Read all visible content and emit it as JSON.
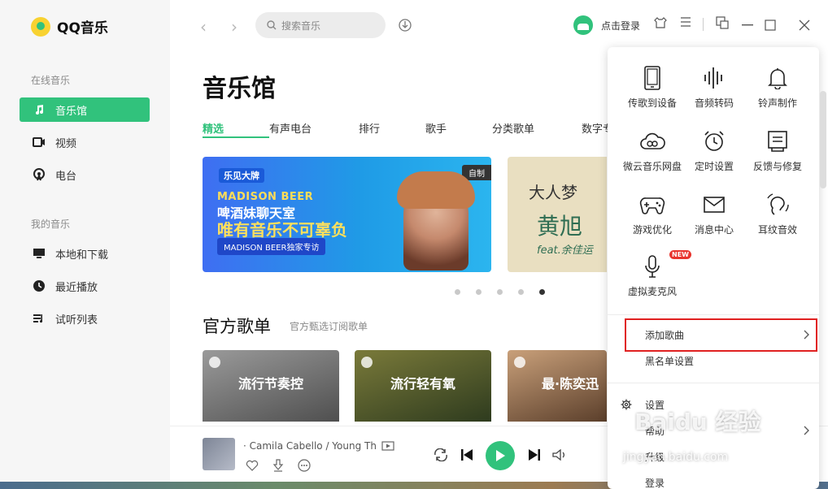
{
  "app": {
    "name": "QQ音乐"
  },
  "sidebar": {
    "section_online": "在线音乐",
    "section_mine": "我的音乐",
    "items": [
      {
        "label": "音乐馆",
        "icon": "music-note-icon",
        "active": true
      },
      {
        "label": "视频",
        "icon": "video-icon"
      },
      {
        "label": "电台",
        "icon": "radio-icon"
      },
      {
        "label": "本地和下载",
        "icon": "monitor-icon"
      },
      {
        "label": "最近播放",
        "icon": "clock-icon"
      },
      {
        "label": "试听列表",
        "icon": "playlist-icon"
      }
    ]
  },
  "topbar": {
    "search_placeholder": "搜索音乐",
    "login": "点击登录"
  },
  "main": {
    "title": "音乐馆",
    "tabs": [
      "精选",
      "有声电台",
      "排行",
      "歌手",
      "分类歌单",
      "数字专"
    ],
    "banner1": {
      "brand": "乐见大牌",
      "tag": "自制",
      "line1": "MADISON BEER",
      "line2": "啤酒妹聊天室",
      "line3": "唯有音乐不可辜负",
      "pill": "MADISON BEER独家专访"
    },
    "banner2": {
      "t1": "大人梦",
      "t2": "黄旭",
      "t3": "feat.余佳运"
    },
    "section_title": "官方歌单",
    "section_sub": "官方甄选订阅歌单",
    "playlists": [
      "流行节奏控",
      "流行轻有氧",
      "最·陈奕迅"
    ]
  },
  "player": {
    "song": "· Camila Cabello / Young Th"
  },
  "dropdown": {
    "grid": [
      {
        "label": "传歌到设备",
        "icon": "phone-icon"
      },
      {
        "label": "音频转码",
        "icon": "waveform-icon"
      },
      {
        "label": "铃声制作",
        "icon": "bell-icon"
      },
      {
        "label": "微云音乐网盘",
        "icon": "cloud-icon"
      },
      {
        "label": "定时设置",
        "icon": "alarm-clock-icon"
      },
      {
        "label": "反馈与修复",
        "icon": "feedback-icon"
      },
      {
        "label": "游戏优化",
        "icon": "gamepad-icon"
      },
      {
        "label": "消息中心",
        "icon": "mail-icon"
      },
      {
        "label": "耳纹音效",
        "icon": "ear-icon"
      },
      {
        "label": "虚拟麦克风",
        "icon": "microphone-icon",
        "badge": "NEW"
      }
    ],
    "add_song": "添加歌曲",
    "blacklist": "黑名单设置",
    "settings": "设置",
    "help": "帮助",
    "upgrade": "升级",
    "login": "登录"
  },
  "watermark": {
    "main": "Baidu 经验",
    "sub": "jingyan.baidu.com"
  },
  "colors": {
    "accent": "#31c27c",
    "highlight": "#e02020"
  }
}
